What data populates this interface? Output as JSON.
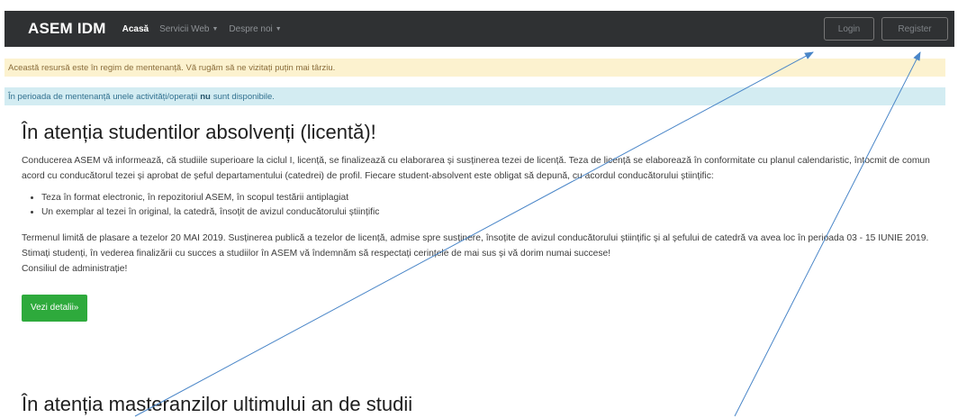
{
  "navbar": {
    "brand": "ASEM IDM",
    "items": [
      {
        "label": "Acasă",
        "active": true,
        "dropdown": false
      },
      {
        "label": "Servicii Web",
        "active": false,
        "dropdown": true
      },
      {
        "label": "Despre noi",
        "active": false,
        "dropdown": true
      }
    ],
    "login_label": "Login",
    "register_label": "Register"
  },
  "alerts": {
    "warning": "Această resursă este în regim de mentenanță. Vă rugăm să ne vizitați puțin mai târziu.",
    "info_before": "În perioada de mentenanță unele activități/operații",
    "info_bold": "nu",
    "info_after": "sunt disponibile."
  },
  "article1": {
    "title": "În atenția studentilor absolvenți (licentă)!",
    "intro": "Conducerea ASEM vă informează, că studiile superioare la ciclul I, licență, se finalizează cu elaborarea și susținerea tezei de licență. Teza de licență se elaborează în conformitate cu planul calendaristic, întocmit de comun acord cu conducătorul tezei și aprobat de șeful departamentului (catedrei) de profil. Fiecare student-absolvent este obligat să depună, cu acordul conducătorului științific:",
    "bullets": [
      "Teza în format electronic, în repozitoriul ASEM, în scopul testării antiplagiat",
      "Un exemplar al tezei în original, la catedră, însoțit de avizul conducătorului științific"
    ],
    "p1": "Termenul limită de plasare a tezelor 20 MAI 2019. Susținerea publică a tezelor de licență, admise spre susținere, însoțite de avizul conducătorului științific și al șefului de catedră va avea loc în perioada 03 - 15 IUNIE 2019.",
    "p2": "Stimați studenți, în vederea finalizării cu succes a studiilor în ASEM vă îndemnăm să respectați cerințele de mai sus și vă dorim numai succese!",
    "p3": "Consiliul de administrație!",
    "button": "Vezi detalii»"
  },
  "article2": {
    "title": "În atenția masteranzilor ultimului an de studii"
  },
  "annotation": {
    "arrow_color": "#4a86c8"
  }
}
